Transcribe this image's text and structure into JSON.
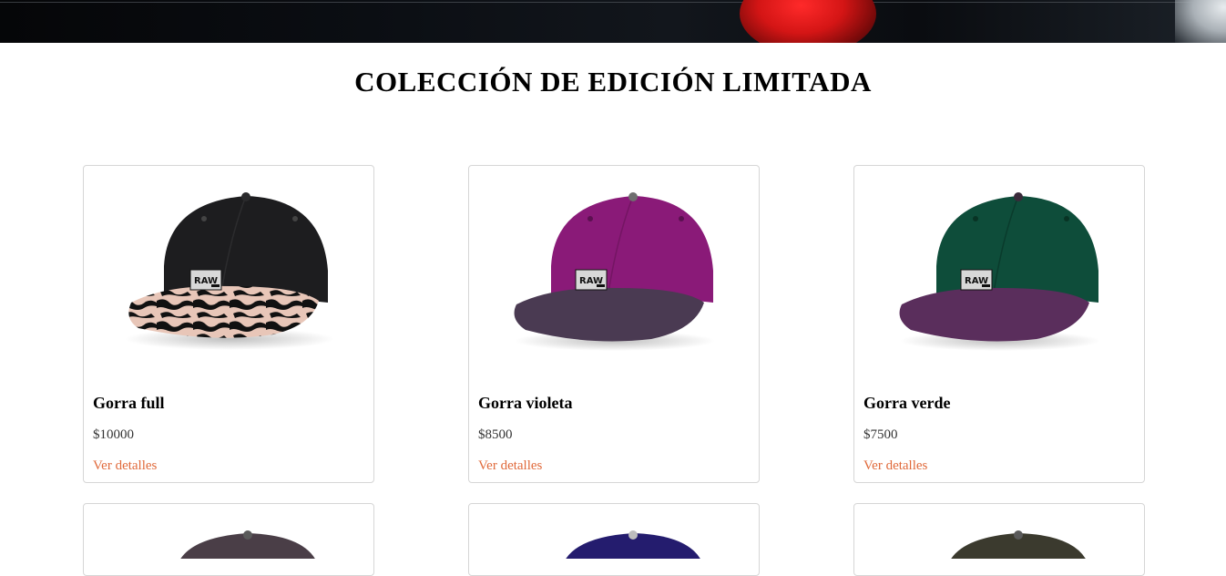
{
  "section": {
    "title": "COLECCIÓN DE EDICIÓN LIMITADA"
  },
  "products": [
    {
      "name": "Gorra full",
      "price": "$10000",
      "link_label": "Ver detalles",
      "crown_color": "#1d1d1f",
      "brim_color": "#e8c6b8",
      "brim_pattern": "camo"
    },
    {
      "name": "Gorra violeta",
      "price": "$8500",
      "link_label": "Ver detalles",
      "crown_color": "#8a1a78",
      "brim_color": "#4a3a52",
      "brim_pattern": "solid"
    },
    {
      "name": "Gorra verde",
      "price": "$7500",
      "link_label": "Ver detalles",
      "crown_color": "#0e4d3a",
      "brim_color": "#5a2e5c",
      "brim_pattern": "solid"
    }
  ],
  "next_row_preview": [
    {
      "crown_color": "#4a3e47"
    },
    {
      "crown_color": "#241c6e"
    },
    {
      "crown_color": "#3b3a2e"
    }
  ],
  "patch_text": "RAW",
  "colors": {
    "link": "#e0693a",
    "card_border": "#d6d6d6"
  }
}
